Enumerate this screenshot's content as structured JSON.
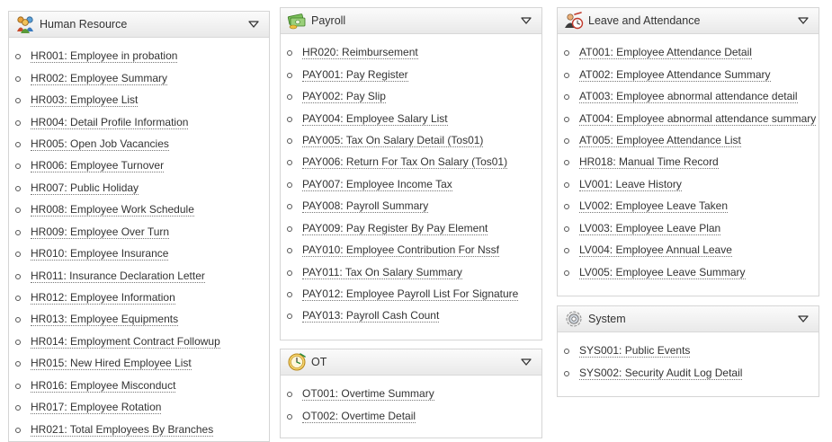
{
  "panels": {
    "hr": {
      "title": "Human Resource",
      "icon": "people-group-icon",
      "items": [
        "HR001: Employee in probation",
        "HR002: Employee Summary",
        "HR003: Employee List",
        "HR004: Detail Profile Information",
        "HR005: Open Job Vacancies",
        "HR006: Employee Turnover",
        "HR007: Public Holiday",
        "HR008: Employee Work Schedule",
        "HR009: Employee Over Turn",
        "HR010: Employee Insurance",
        "HR011: Insurance Declaration Letter",
        "HR012: Employee Information",
        "HR013: Employee Equipments",
        "HR014: Employment Contract Followup",
        "HR015: New Hired Employee List",
        "HR016: Employee Misconduct",
        "HR017: Employee Rotation",
        "HR021: Total Employees By Branches"
      ]
    },
    "payroll": {
      "title": "Payroll",
      "icon": "money-bill-icon",
      "items": [
        "HR020: Reimbursement",
        "PAY001: Pay Register",
        "PAY002: Pay Slip",
        "PAY004: Employee Salary List",
        "PAY005: Tax On Salary Detail (Tos01)",
        "PAY006: Return For Tax On Salary (Tos01)",
        "PAY007: Employee Income Tax",
        "PAY008: Payroll Summary",
        "PAY009: Pay Register By Pay Element",
        "PAY010: Employee Contribution For Nssf",
        "PAY011: Tax On Salary Summary",
        "PAY012: Employee Payroll List For Signature",
        "PAY013: Payroll Cash Count"
      ]
    },
    "ot": {
      "title": "OT",
      "icon": "clock-icon",
      "items": [
        "OT001: Overtime Summary",
        "OT002: Overtime Detail"
      ]
    },
    "leave": {
      "title": "Leave and Attendance",
      "icon": "attendance-icon",
      "items": [
        "AT001: Employee Attendance Detail",
        "AT002: Employee Attendance Summary",
        "AT003: Employee abnormal attendance detail",
        "AT004: Employee abnormal attendance summary",
        "AT005: Employee Attendance List",
        "HR018: Manual Time Record",
        "LV001: Leave History",
        "LV002: Employee Leave Taken",
        "LV003: Employee Leave Plan",
        "LV004: Employee Annual Leave",
        "LV005: Employee Leave Summary"
      ]
    },
    "system": {
      "title": "System",
      "icon": "gear-icon",
      "items": [
        "SYS001: Public Events",
        "SYS002: Security Audit Log Detail"
      ]
    }
  }
}
